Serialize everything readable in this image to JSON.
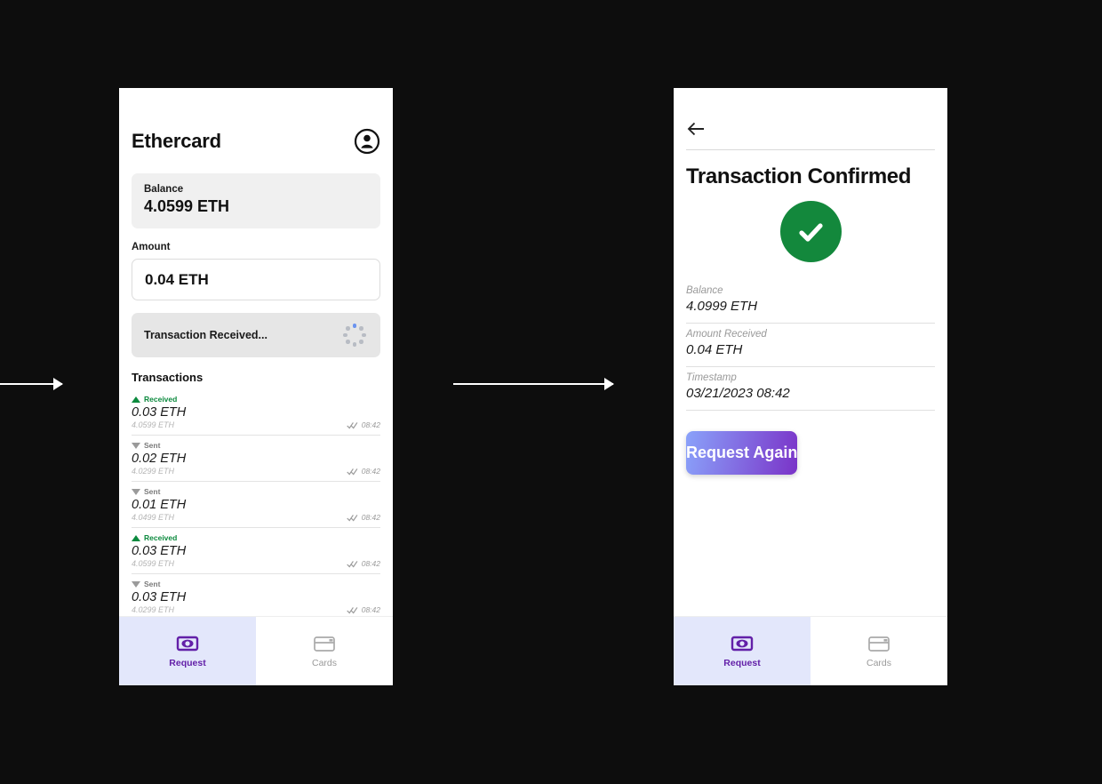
{
  "theme": {
    "canvas_bg": "#0d0d0d",
    "accent_purple": "#6320a8",
    "success_green": "#13883c",
    "nav_active_bg": "#e3e7fb",
    "spinner_active": "#6b93ef",
    "cta_gradient_from": "#8aa2fa",
    "cta_gradient_to": "#7a33c8"
  },
  "left_screen": {
    "app_title": "Ethercard",
    "account_icon": "account-circle-icon",
    "balance": {
      "label": "Balance",
      "value": "4.0599 ETH"
    },
    "amount": {
      "label": "Amount",
      "value": "0.04 ETH"
    },
    "toast": {
      "text": "Transaction Received...",
      "spinner_icon": "loading-spinner-icon"
    },
    "transactions_heading": "Transactions",
    "transactions": [
      {
        "type": "Received",
        "direction": "up",
        "amount": "0.03 ETH",
        "running_balance": "4.0599 ETH",
        "time": "08:42",
        "status_icon": "double-check-icon"
      },
      {
        "type": "Sent",
        "direction": "down",
        "amount": "0.02 ETH",
        "running_balance": "4.0299 ETH",
        "time": "08:42",
        "status_icon": "double-check-icon"
      },
      {
        "type": "Sent",
        "direction": "down",
        "amount": "0.01 ETH",
        "running_balance": "4.0499 ETH",
        "time": "08:42",
        "status_icon": "double-check-icon"
      },
      {
        "type": "Received",
        "direction": "up",
        "amount": "0.03 ETH",
        "running_balance": "4.0599 ETH",
        "time": "08:42",
        "status_icon": "double-check-icon"
      },
      {
        "type": "Sent",
        "direction": "down",
        "amount": "0.03 ETH",
        "running_balance": "4.0299 ETH",
        "time": "08:42",
        "status_icon": "double-check-icon"
      }
    ]
  },
  "right_screen": {
    "back_icon": "back-arrow-icon",
    "title": "Transaction Confirmed",
    "status_icon": "success-check-icon",
    "details": [
      {
        "label": "Balance",
        "value": "4.0999 ETH"
      },
      {
        "label": "Amount Received",
        "value": "0.04 ETH"
      },
      {
        "label": "Timestamp",
        "value": "03/21/2023 08:42"
      }
    ],
    "cta_label": "Request Again"
  },
  "bottom_nav": {
    "items": [
      {
        "label": "Request",
        "icon": "money-request-icon",
        "active": true
      },
      {
        "label": "Cards",
        "icon": "credit-card-icon",
        "active": false
      }
    ]
  }
}
